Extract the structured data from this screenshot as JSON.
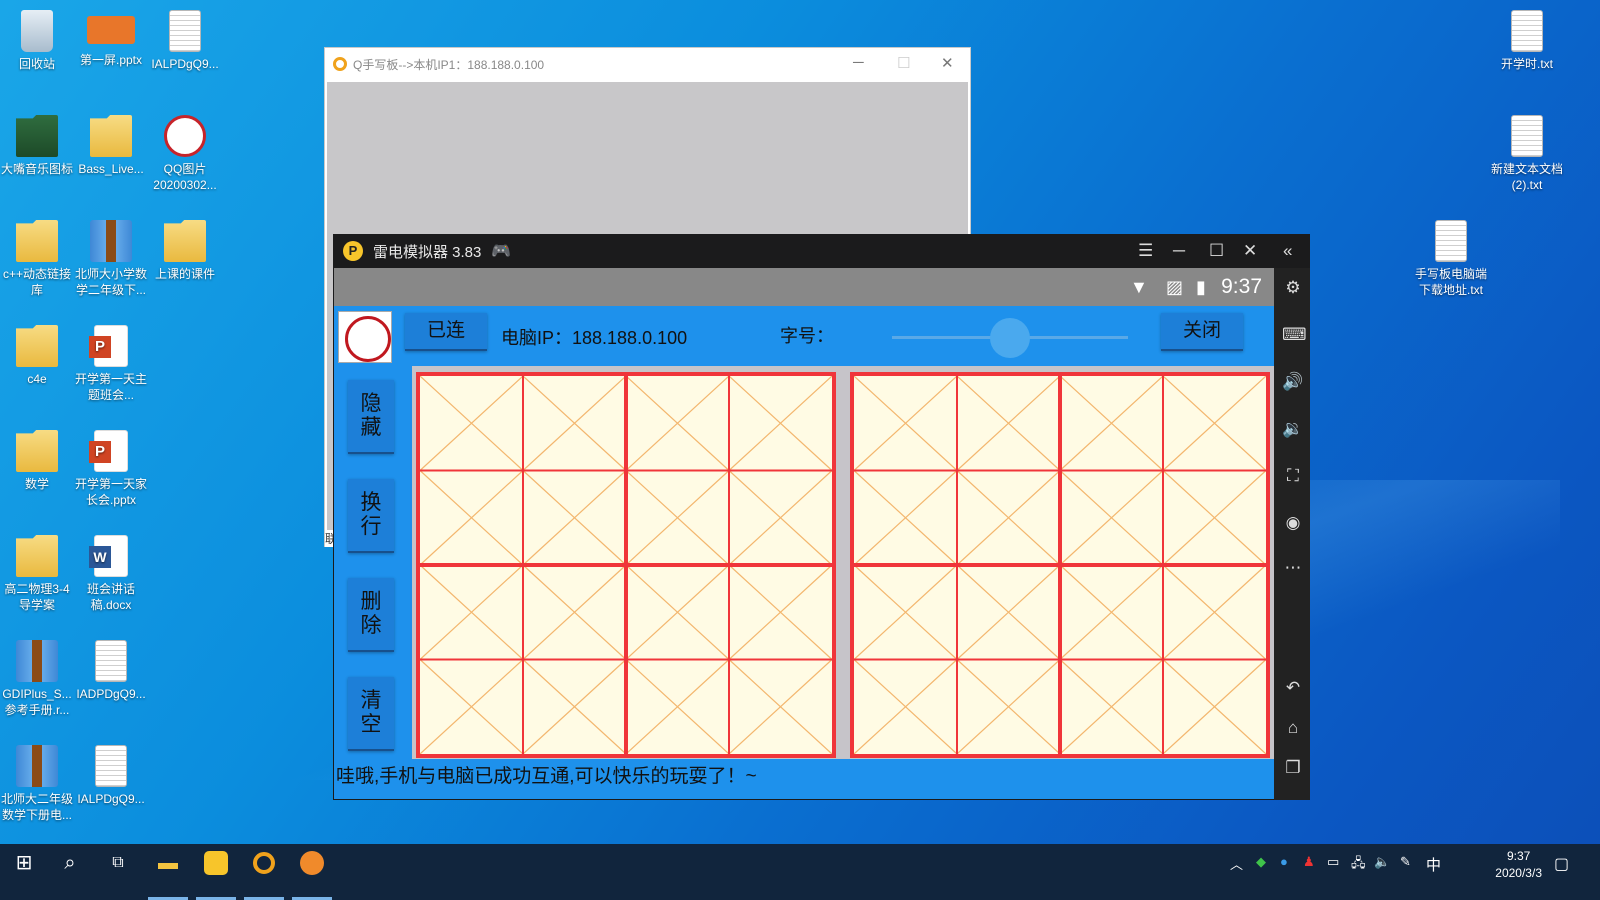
{
  "desktop": {
    "icons": [
      {
        "label": "回收站",
        "icon": "recycle-bin-icon"
      },
      {
        "label": "第一屏.pptx",
        "icon": "pptx-thumbnail-icon"
      },
      {
        "label": "IALPDgQ9...",
        "icon": "image-file-icon"
      },
      {
        "label": "大嘴音乐图标",
        "icon": "folder-icon"
      },
      {
        "label": "Bass_Live...",
        "icon": "folder-icon"
      },
      {
        "label": "QQ图片20200302...",
        "icon": "qq-image-icon"
      },
      {
        "label": "c++动态链接库",
        "icon": "folder-icon"
      },
      {
        "label": "北师大小学数学二年级下...",
        "icon": "winrar-archive-icon"
      },
      {
        "label": "上课的课件",
        "icon": "folder-icon"
      },
      {
        "label": "c4e",
        "icon": "folder-icon"
      },
      {
        "label": "开学第一天主题班会...",
        "icon": "powerpoint-file-icon"
      },
      {
        "label": "数学",
        "icon": "folder-icon"
      },
      {
        "label": "开学第一天家长会.pptx",
        "icon": "powerpoint-file-icon"
      },
      {
        "label": "高二物理3-4导学案",
        "icon": "folder-icon"
      },
      {
        "label": "班会讲话稿.docx",
        "icon": "word-file-icon"
      },
      {
        "label": "GDIPlus_S...参考手册.r...",
        "icon": "winrar-archive-icon"
      },
      {
        "label": "IADPDgQ9...",
        "icon": "image-file-icon"
      },
      {
        "label": "北师大二年级数学下册电...",
        "icon": "winrar-archive-icon"
      },
      {
        "label": "IALPDgQ9...",
        "icon": "image-file-icon"
      },
      {
        "label": "开学时.txt",
        "icon": "text-file-icon"
      },
      {
        "label": "新建文本文档(2).txt",
        "icon": "text-file-icon"
      },
      {
        "label": "手写板电脑端下载地址.txt",
        "icon": "text-file-icon"
      }
    ]
  },
  "q_window": {
    "title": "Q手写板-->本机IP1：188.188.0.100",
    "side_char": "联"
  },
  "emulator": {
    "title": "雷电模拟器 3.83",
    "logo_char": "P",
    "status": {
      "time": "9:37"
    },
    "app": {
      "connect_button": "已连",
      "ip_label": "电脑IP：188.188.0.100",
      "font_size_label": "字号：",
      "font_size_value": "50",
      "font_size_level": 0.5,
      "close_button": "关闭",
      "side_buttons": [
        "隐藏",
        "换行",
        "删除",
        "清空"
      ],
      "message": "哇哦,手机与电脑已成功互通,可以快乐的玩耍了！~"
    }
  },
  "taskbar": {
    "ime": "中",
    "clock_time": "9:37",
    "clock_date": "2020/3/3"
  },
  "colors": {
    "grid_red": "#f0353a",
    "grid_diag": "#f3b66e",
    "paper": "#fffbe4",
    "app_blue": "#1e91ec"
  }
}
